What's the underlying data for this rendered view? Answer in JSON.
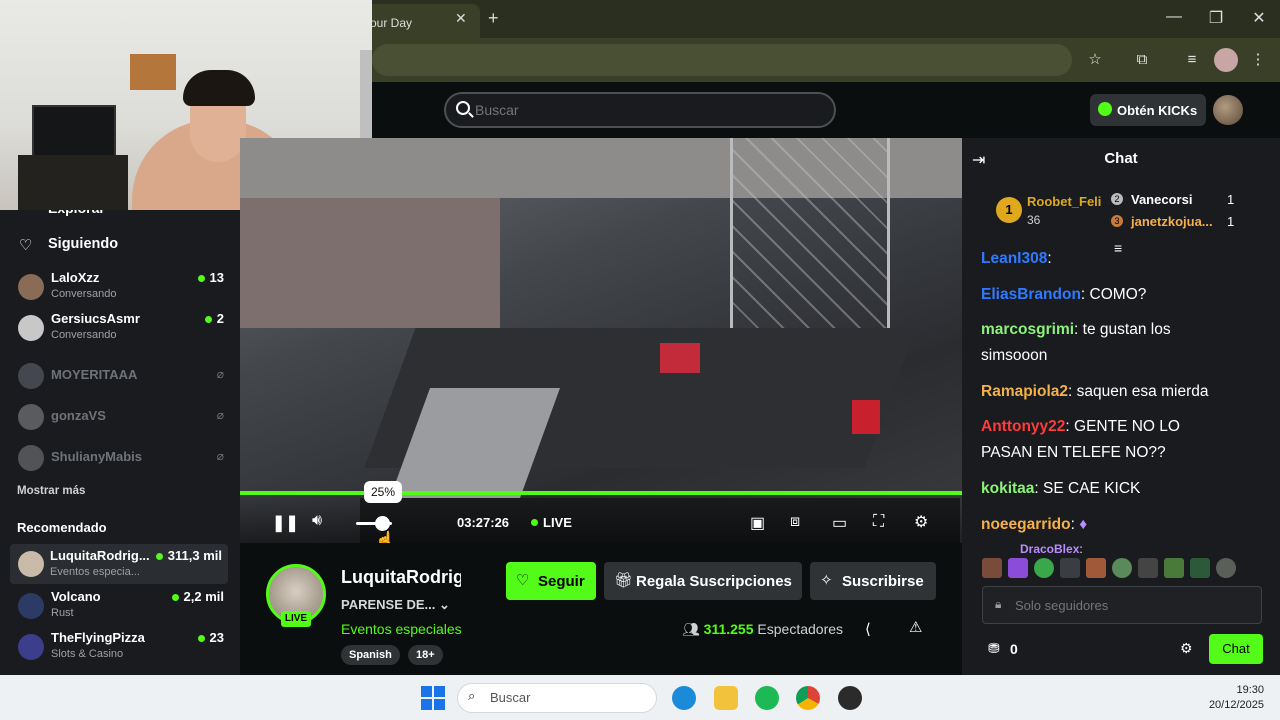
{
  "browser": {
    "tab_title": "our Day",
    "tab_close": "✕",
    "new_tab": "+",
    "controls": {
      "minimize": "—",
      "maximize": "❐",
      "close": "✕"
    }
  },
  "header": {
    "search_placeholder": "Buscar",
    "kicks_label": "Obtén KICKs"
  },
  "sidebar": {
    "explore": "Explorar",
    "following": "Siguiendo",
    "following_items": [
      {
        "name": "LaloXzz",
        "sub": "Conversando",
        "count": "13"
      },
      {
        "name": "GersiucsAsmr",
        "sub": "Conversando",
        "count": "2"
      },
      {
        "name": "MOYERITAAA"
      },
      {
        "name": "gonzaVS"
      },
      {
        "name": "ShulianyMabis"
      }
    ],
    "show_more": "Mostrar más",
    "recommended": "Recomendado",
    "recommended_items": [
      {
        "name": "LuquitaRodrig...",
        "sub": "Eventos especia...",
        "count": "311,3 mil"
      },
      {
        "name": "Volcano",
        "sub": "Rust",
        "count": "2,2 mil"
      },
      {
        "name": "TheFlyingPizza",
        "sub": "Slots & Casino",
        "count": "23"
      }
    ]
  },
  "player": {
    "volume_tooltip": "25%",
    "volume_level": 0.25,
    "elapsed": "03:27:26",
    "live": "LIVE"
  },
  "channel": {
    "name": "LuquitaRodrig",
    "live_badge": "LIVE",
    "title": "PARENSE DE...",
    "category": "Eventos especiales",
    "tags": [
      "Spanish",
      "18+"
    ],
    "follow": "Seguir",
    "gift": "Regala Suscripciones",
    "subscribe": "Suscribirse",
    "viewers_count": "311.255",
    "viewers_label": "Espectadores"
  },
  "chat": {
    "title": "Chat",
    "top_gifters": [
      {
        "rank": "1",
        "name": "Roobet_Feli",
        "count": "36"
      },
      {
        "rank": "2",
        "name": "Vanecorsi",
        "count": "1"
      },
      {
        "rank": "3",
        "name": "janetzkojua...",
        "count": "1"
      }
    ],
    "messages": [
      {
        "user": "LeanI308",
        "text": "",
        "color": "#2f7bff"
      },
      {
        "user": "EliasBrandon",
        "text": "COMO?",
        "color": "#2f7bff"
      },
      {
        "user": "marcosgrimi",
        "text": "te gustan los simsooon",
        "color": "#8df27a"
      },
      {
        "user": "Ramapiola2",
        "text": "saquen esa mierda",
        "color": "#f5b04a"
      },
      {
        "user": "Anttonyy22",
        "text": "GENTE NO LO PASAN EN TELEFE NO??",
        "color": "#ff3b3b"
      },
      {
        "user": "kokitaa",
        "text": "SE CAE KICK",
        "color": "#8df27a"
      },
      {
        "user": "noeegarrido",
        "text": "",
        "color": "#f5b04a"
      },
      {
        "user": "DracoBlex",
        "text": "",
        "color": "#b98cff"
      }
    ],
    "input_placeholder": "Solo seguidores",
    "points": "0",
    "send": "Chat"
  },
  "taskbar": {
    "search": "Buscar",
    "time": "19:30",
    "date": "20/12/2025"
  }
}
